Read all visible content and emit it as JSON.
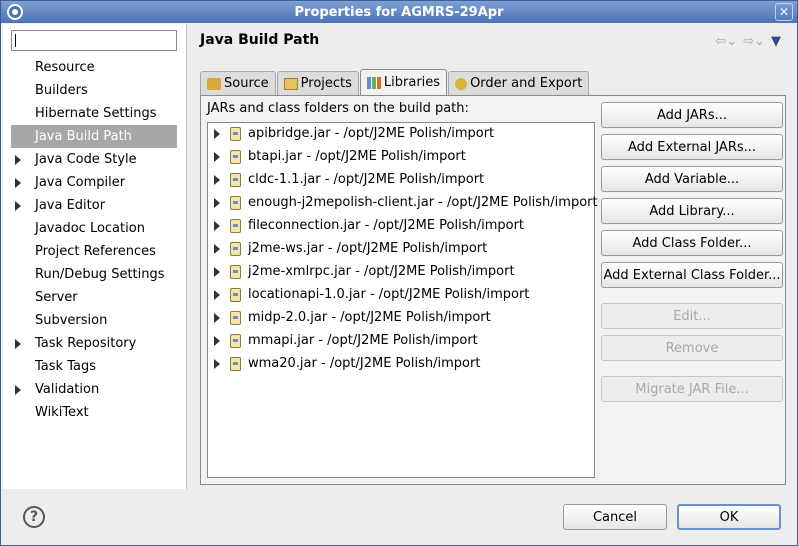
{
  "window": {
    "title": "Properties for AGMRS-29Apr",
    "close_glyph": "✕",
    "app_icon": "eclipse-icon"
  },
  "filter": {
    "value": "",
    "placeholder": ""
  },
  "nav": {
    "items": [
      {
        "label": "Resource",
        "expandable": false,
        "selected": false
      },
      {
        "label": "Builders",
        "expandable": false,
        "selected": false
      },
      {
        "label": "Hibernate Settings",
        "expandable": false,
        "selected": false
      },
      {
        "label": "Java Build Path",
        "expandable": false,
        "selected": true
      },
      {
        "label": "Java Code Style",
        "expandable": true,
        "selected": false
      },
      {
        "label": "Java Compiler",
        "expandable": true,
        "selected": false
      },
      {
        "label": "Java Editor",
        "expandable": true,
        "selected": false
      },
      {
        "label": "Javadoc Location",
        "expandable": false,
        "selected": false
      },
      {
        "label": "Project References",
        "expandable": false,
        "selected": false
      },
      {
        "label": "Run/Debug Settings",
        "expandable": false,
        "selected": false
      },
      {
        "label": "Server",
        "expandable": false,
        "selected": false
      },
      {
        "label": "Subversion",
        "expandable": false,
        "selected": false
      },
      {
        "label": "Task Repository",
        "expandable": true,
        "selected": false
      },
      {
        "label": "Task Tags",
        "expandable": false,
        "selected": false
      },
      {
        "label": "Validation",
        "expandable": true,
        "selected": false
      },
      {
        "label": "WikiText",
        "expandable": false,
        "selected": false
      }
    ]
  },
  "page": {
    "title": "Java Build Path",
    "back_glyph": "⇦⌄",
    "forward_glyph": "⇨⌄",
    "menu_glyph": "▼"
  },
  "tabs": [
    {
      "label": "Source",
      "icon": "source-folder-icon",
      "active": false
    },
    {
      "label": "Projects",
      "icon": "project-icon",
      "active": false
    },
    {
      "label": "Libraries",
      "icon": "libraries-icon",
      "active": true
    },
    {
      "label": "Order and Export",
      "icon": "order-export-icon",
      "active": false
    }
  ],
  "libraries": {
    "description": "JARs and class folders on the build path:",
    "items": [
      "apibridge.jar - /opt/J2ME Polish/import",
      "btapi.jar - /opt/J2ME Polish/import",
      "cldc-1.1.jar - /opt/J2ME Polish/import",
      "enough-j2mepolish-client.jar - /opt/J2ME Polish/import",
      "fileconnection.jar - /opt/J2ME Polish/import",
      "j2me-ws.jar - /opt/J2ME Polish/import",
      "j2me-xmlrpc.jar - /opt/J2ME Polish/import",
      "locationapi-1.0.jar - /opt/J2ME Polish/import",
      "midp-2.0.jar - /opt/J2ME Polish/import",
      "mmapi.jar - /opt/J2ME Polish/import",
      "wma20.jar - /opt/J2ME Polish/import"
    ]
  },
  "buttons": {
    "add_jars": "Add JARs...",
    "add_external_jars": "Add External JARs...",
    "add_variable": "Add Variable...",
    "add_library": "Add Library...",
    "add_class_folder": "Add Class Folder...",
    "add_external_class_folder": "Add External Class Folder...",
    "edit": "Edit...",
    "remove": "Remove",
    "migrate_jar": "Migrate JAR File..."
  },
  "dialog": {
    "help_glyph": "?",
    "cancel": "Cancel",
    "ok": "OK"
  }
}
